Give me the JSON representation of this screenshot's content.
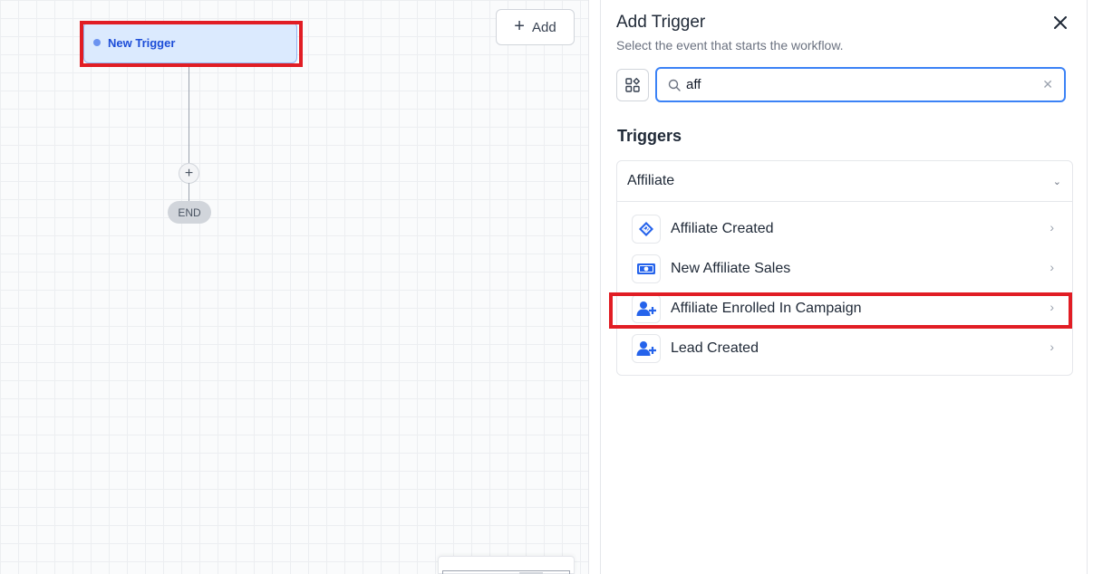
{
  "canvas": {
    "trigger_node_label": "New Trigger",
    "add_node_symbol": "+",
    "end_label": "END",
    "add_button": {
      "icon": "plus-icon",
      "label": "Add"
    }
  },
  "panel": {
    "title": "Add Trigger",
    "subtitle": "Select the event that starts the workflow.",
    "close_icon": "close-icon",
    "grid_icon": "grid-icon",
    "search": {
      "value": "aff",
      "placeholder": ""
    },
    "section_heading": "Triggers",
    "group": {
      "title": "Affiliate",
      "items": [
        {
          "label": "Affiliate Created",
          "icon": "handshake-icon"
        },
        {
          "label": "New Affiliate Sales",
          "icon": "cash-icon"
        },
        {
          "label": "Affiliate Enrolled In Campaign",
          "icon": "user-plus-icon"
        },
        {
          "label": "Lead Created",
          "icon": "user-plus-icon"
        }
      ]
    }
  },
  "colors": {
    "accent": "#3b82f6",
    "icon_blue": "#2563eb",
    "trigger_fill": "#dbeafe",
    "highlight": "#e11d24"
  }
}
